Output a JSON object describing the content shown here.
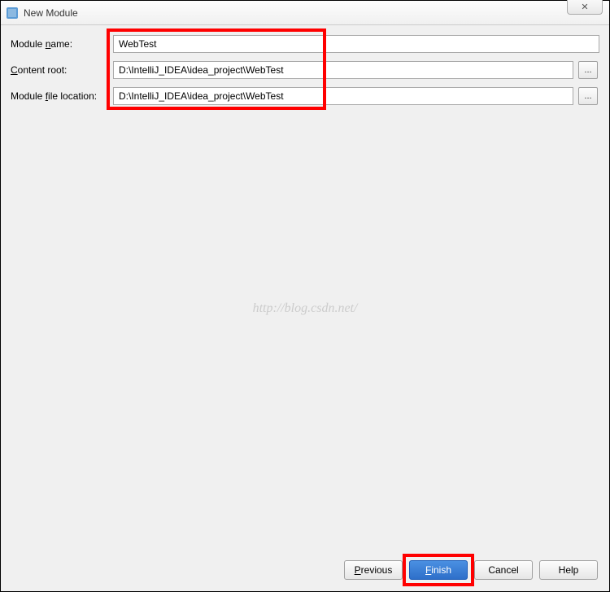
{
  "window": {
    "title": "New Module",
    "close_glyph": "✕"
  },
  "form": {
    "module_name_label": "Module name:",
    "module_name_value": "WebTest",
    "content_root_label": "Content root:",
    "content_root_value": "D:\\IntelliJ_IDEA\\idea_project\\WebTest",
    "module_file_label": "Module file location:",
    "module_file_value": "D:\\IntelliJ_IDEA\\idea_project\\WebTest",
    "browse_glyph": "..."
  },
  "watermark": "http://blog.csdn.net/",
  "buttons": {
    "previous": "Previous",
    "finish": "Finish",
    "cancel": "Cancel",
    "help": "Help"
  }
}
